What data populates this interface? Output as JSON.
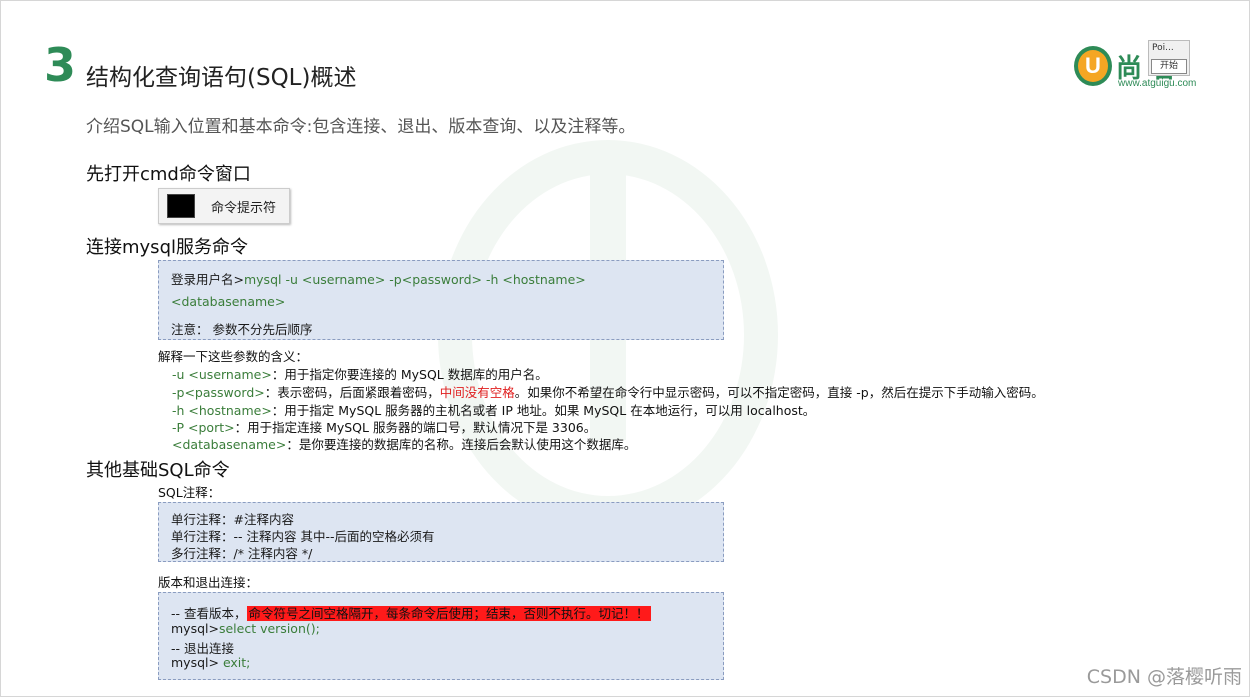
{
  "header": {
    "number": "3",
    "title": "结构化查询语句(SQL)概述",
    "subtitle": "介绍SQL输入位置和基本命令:包含连接、退出、版本查询、以及注释等。"
  },
  "logo": {
    "mark": "U",
    "text": "尚  谷",
    "url": "www.atguigu.com"
  },
  "popup": {
    "title": "Poi...",
    "button": "开始"
  },
  "sections": {
    "open_cmd": {
      "heading": "先打开cmd命令窗口",
      "button_label": "命令提示符"
    },
    "connect": {
      "heading": "连接mysql服务命令",
      "code_line1_prefix": "登录用户名>",
      "code_line1_cmd": "mysql -u <username> -p<password> -h <hostname>",
      "code_line2": "<databasename>",
      "code_line3": "注意：  参数不分先后顺序"
    },
    "explain": {
      "intro": "解释一下这些参数的含义：",
      "u_param": "-u <username>",
      "u_text": "：用于指定你要连接的 MySQL 数据库的用户名。",
      "p_param": "-p<password>",
      "p_text_a": "：表示密码，后面紧跟着密码，",
      "p_red": "中间没有空格",
      "p_text_b": "。如果你不希望在命令行中显示密码，可以不指定密码，直接 -p，然后在提示下手动输入密码。",
      "h_param": "-h <hostname>",
      "h_text": "：用于指定 MySQL 服务器的主机名或者 IP 地址。如果 MySQL 在本地运行，可以用 localhost。",
      "P_param": "-P <port>",
      "P_text": "：用于指定连接 MySQL 服务器的端口号，默认情况下是 3306。",
      "db_param": "<databasename>",
      "db_text": "：是你要连接的数据库的名称。连接后会默认使用这个数据库。"
    },
    "other": {
      "heading": "其他基础SQL命令",
      "comment_label": "SQL注释：",
      "comment_line1": "单行注释：#注释内容",
      "comment_line2": "单行注释：-- 注释内容     其中--后面的空格必须有",
      "comment_line3": "多行注释：/* 注释内容 */",
      "version_label": "版本和退出连接：",
      "v_line1_prefix": "-- 查看版本，",
      "v_line1_highlight": "命令符号之间空格隔开，每条命令后使用；结束，否则不执行。切记！！",
      "v_line2_prefix": "mysql>",
      "v_line2_cmd": "select version();",
      "v_line3": "-- 退出连接",
      "v_line4_prefix": "mysql>",
      "v_line4_cmd": " exit;"
    }
  },
  "footer": "CSDN @落樱听雨",
  "colors": {
    "accent": "#2e8b57",
    "highlight": "#ff1a1a",
    "box_bg": "#dde5f2"
  }
}
